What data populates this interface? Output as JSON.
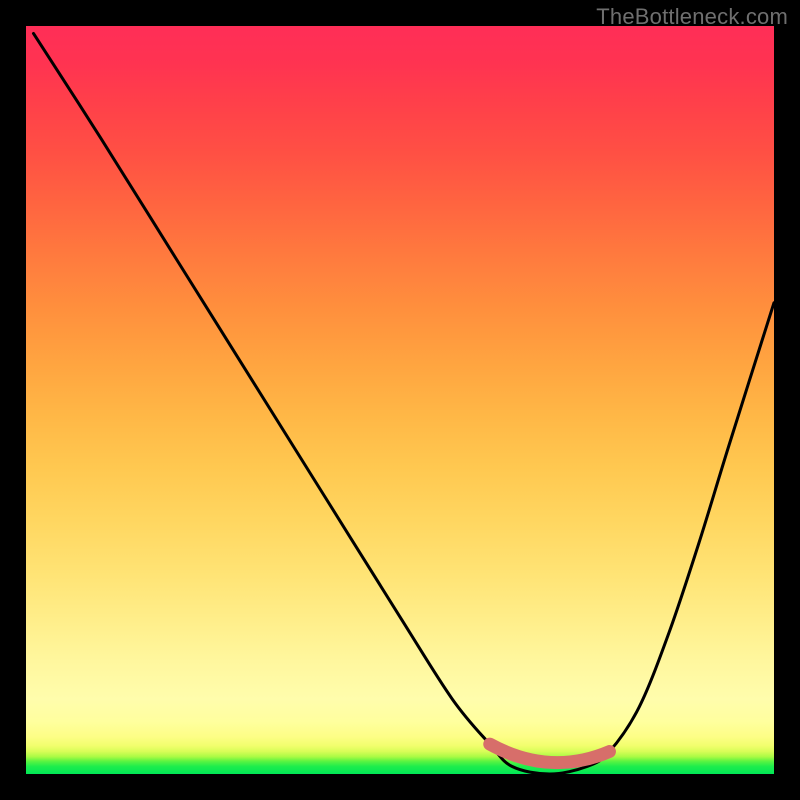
{
  "watermark": {
    "text": "TheBottleneck.com"
  },
  "chart_data": {
    "type": "line",
    "title": "",
    "xlabel": "",
    "ylabel": "",
    "xlim": [
      0,
      100
    ],
    "ylim": [
      0,
      100
    ],
    "background_gradient": {
      "orientation": "vertical_bottom_to_top",
      "stops": [
        {
          "pct": 0,
          "color": "#00e756",
          "meaning": "optimal"
        },
        {
          "pct": 5,
          "color": "#fdfe86"
        },
        {
          "pct": 50,
          "color": "#ffb746"
        },
        {
          "pct": 100,
          "color": "#ff2e57",
          "meaning": "severe bottleneck"
        }
      ]
    },
    "series": [
      {
        "name": "bottleneck-curve",
        "description": "V-shaped bottleneck severity curve; valley marks balanced configuration",
        "x": [
          1,
          10,
          20,
          30,
          40,
          50,
          57,
          62,
          65,
          70,
          75,
          78,
          82,
          86,
          90,
          94,
          100
        ],
        "values": [
          99,
          85,
          69,
          53,
          37,
          21,
          10,
          4,
          1,
          0,
          1,
          3,
          9,
          19,
          31,
          44,
          63
        ]
      }
    ],
    "optimal_range": {
      "description": "flat valley segment highlighted in coral",
      "x_start": 62,
      "x_end": 78,
      "marker_color": "#d76e6a"
    }
  }
}
